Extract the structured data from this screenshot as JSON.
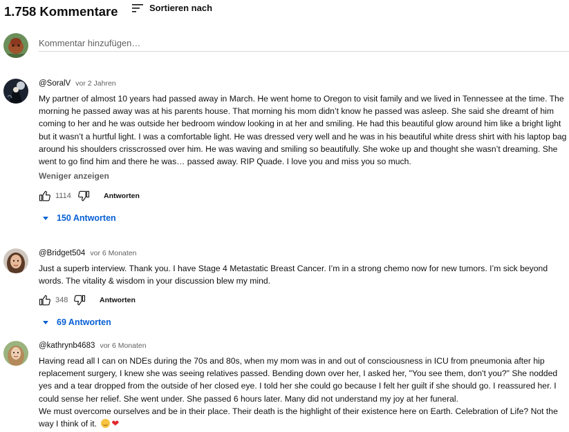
{
  "header": {
    "count": "1.758 Kommentare",
    "sort_label": "Sortieren nach",
    "sort_icon": "sort-icon"
  },
  "add_comment": {
    "placeholder": "Kommentar hinzufügen…"
  },
  "comments": [
    {
      "author": "@SoralV",
      "time": "vor 2 Jahren",
      "text": "My partner of almost 10 years had passed away in March.  He went home to Oregon to visit family and we lived in Tennessee at the time.  The morning he passed away was at his parents house.  That morning his mom didn’t know he passed was asleep.  She said she dreamt of him coming to her and he was outside her bedroom window looking in at her and smiling.  He had this beautiful glow around him like a bright light but it wasn’t a hurtful light.  I was a comfortable light.  He was dressed very well and he was in his beautiful white dress shirt with his laptop bag around his shoulders crisscrossed over him.  He was waving and smiling so beautifully.  She woke up and thought she wasn’t dreaming.  She went to go find him and there he was… passed away.  RIP Quade.  I love you and miss you so much.",
      "show_less": "Weniger anzeigen",
      "likes": "1114",
      "reply_label": "Antworten",
      "replies_label": "150 Antworten"
    },
    {
      "author": "@Bridget504",
      "time": "vor 6 Monaten",
      "text": "Just a superb interview. Thank you. I have Stage 4 Metastatic Breast Cancer. I’m in a strong chemo  now for new tumors. I’m sick beyond words. The vitality & wisdom in your discussion blew my mind.",
      "likes": "348",
      "reply_label": "Antworten",
      "replies_label": "69 Antworten"
    },
    {
      "author": "@kathrynb4683",
      "time": "vor 6 Monaten",
      "text": "Having read all I can on NDEs during the 70s and 80s, when my mom was in and out of consciousness in ICU from pneumonia after hip replacement surgery, I knew she was seeing relatives passed. Bending down over her, I asked her, \"You see them, don't you?\" She nodded yes and a tear dropped from the outside of her closed eye. I told her she could go because I felt her guilt if she should go. I reassured her. I could sense her relief. She went under. She passed 6 hours later. Many did not understand my joy at her funeral.",
      "text2": "We must overcome ourselves and be in their place. Their death is the highlight of their existence here on Earth. Celebration of Life?  Not the way I think of it.",
      "emojis": [
        "smiling-face-emoji",
        "red-heart-emoji"
      ]
    }
  ]
}
